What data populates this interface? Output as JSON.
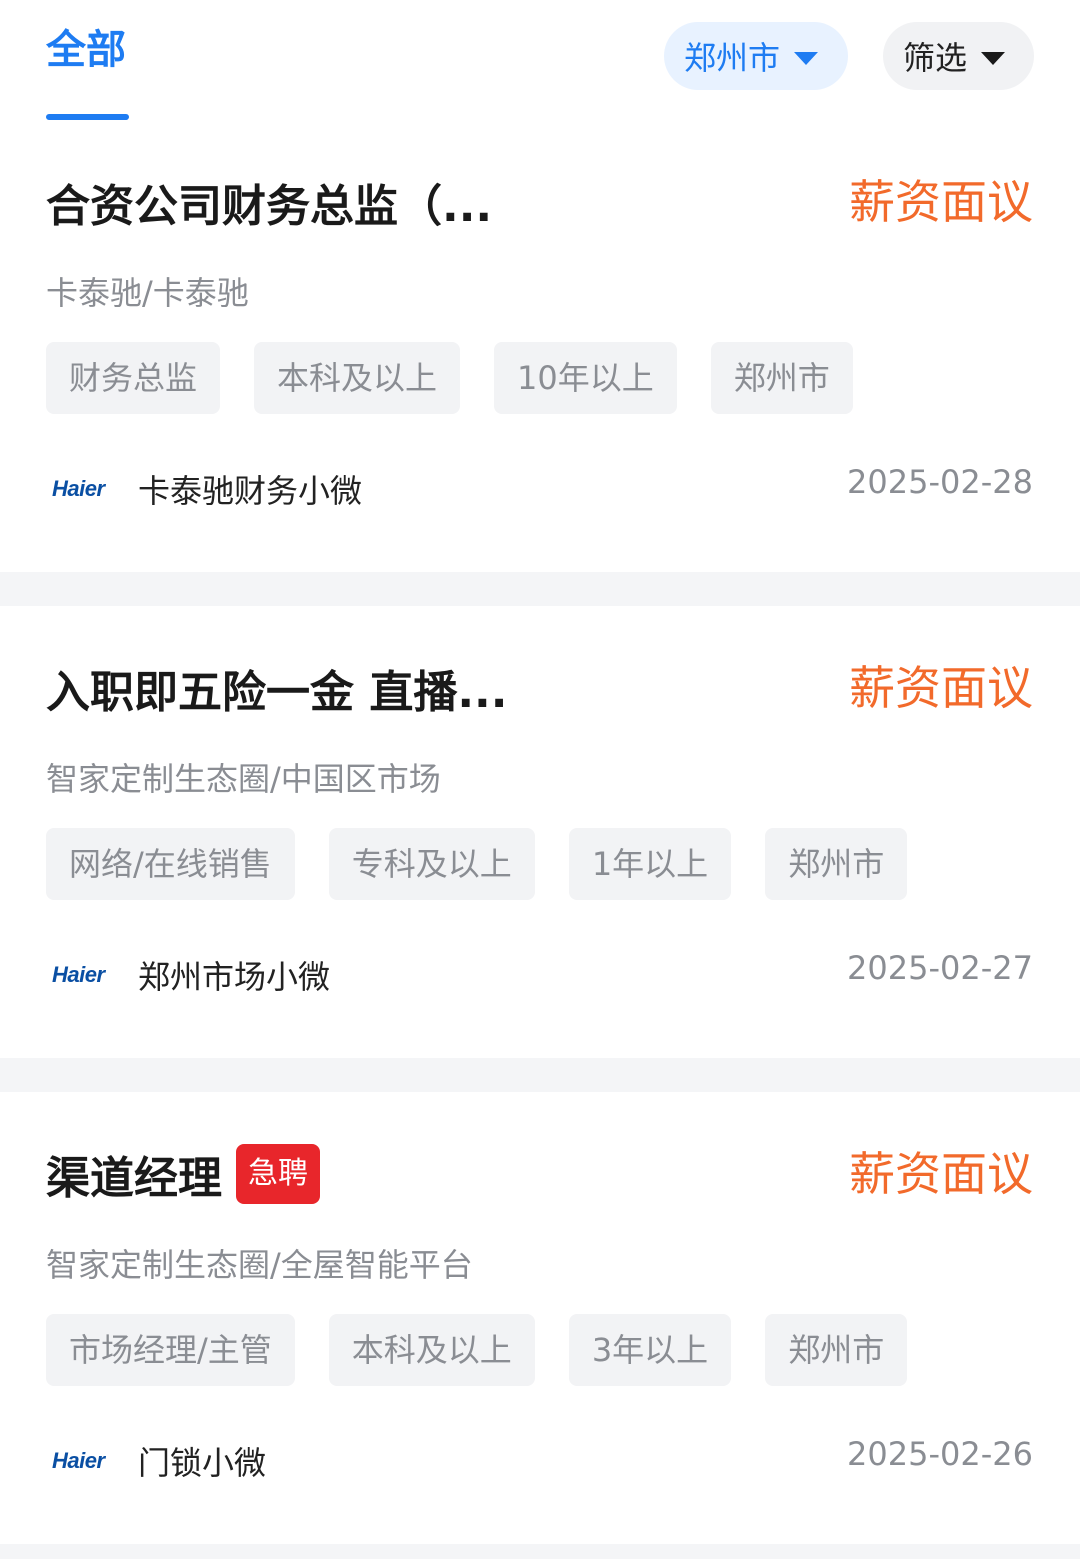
{
  "header": {
    "tab_all": "全部",
    "city_filter": "郑州市",
    "filter_label": "筛选"
  },
  "jobs": [
    {
      "title": "合资公司财务总监（...",
      "salary": "薪资面议",
      "department": "卡泰驰/卡泰驰",
      "tags": [
        "财务总监",
        "本科及以上",
        "10年以上",
        "郑州市"
      ],
      "logo": "Haier",
      "company": "卡泰驰财务小微",
      "date": "2025-02-28"
    },
    {
      "title": "入职即五险一金 直播...",
      "salary": "薪资面议",
      "department": "智家定制生态圈/中国区市场",
      "tags": [
        "网络/在线销售",
        "专科及以上",
        "1年以上",
        "郑州市"
      ],
      "logo": "Haier",
      "company": "郑州市场小微",
      "date": "2025-02-27"
    },
    {
      "title": "渠道经理",
      "badge": "急聘",
      "salary": "薪资面议",
      "department": "智家定制生态圈/全屋智能平台",
      "tags": [
        "市场经理/主管",
        "本科及以上",
        "3年以上",
        "郑州市"
      ],
      "logo": "Haier",
      "company": "门锁小微",
      "date": "2025-02-26"
    }
  ]
}
